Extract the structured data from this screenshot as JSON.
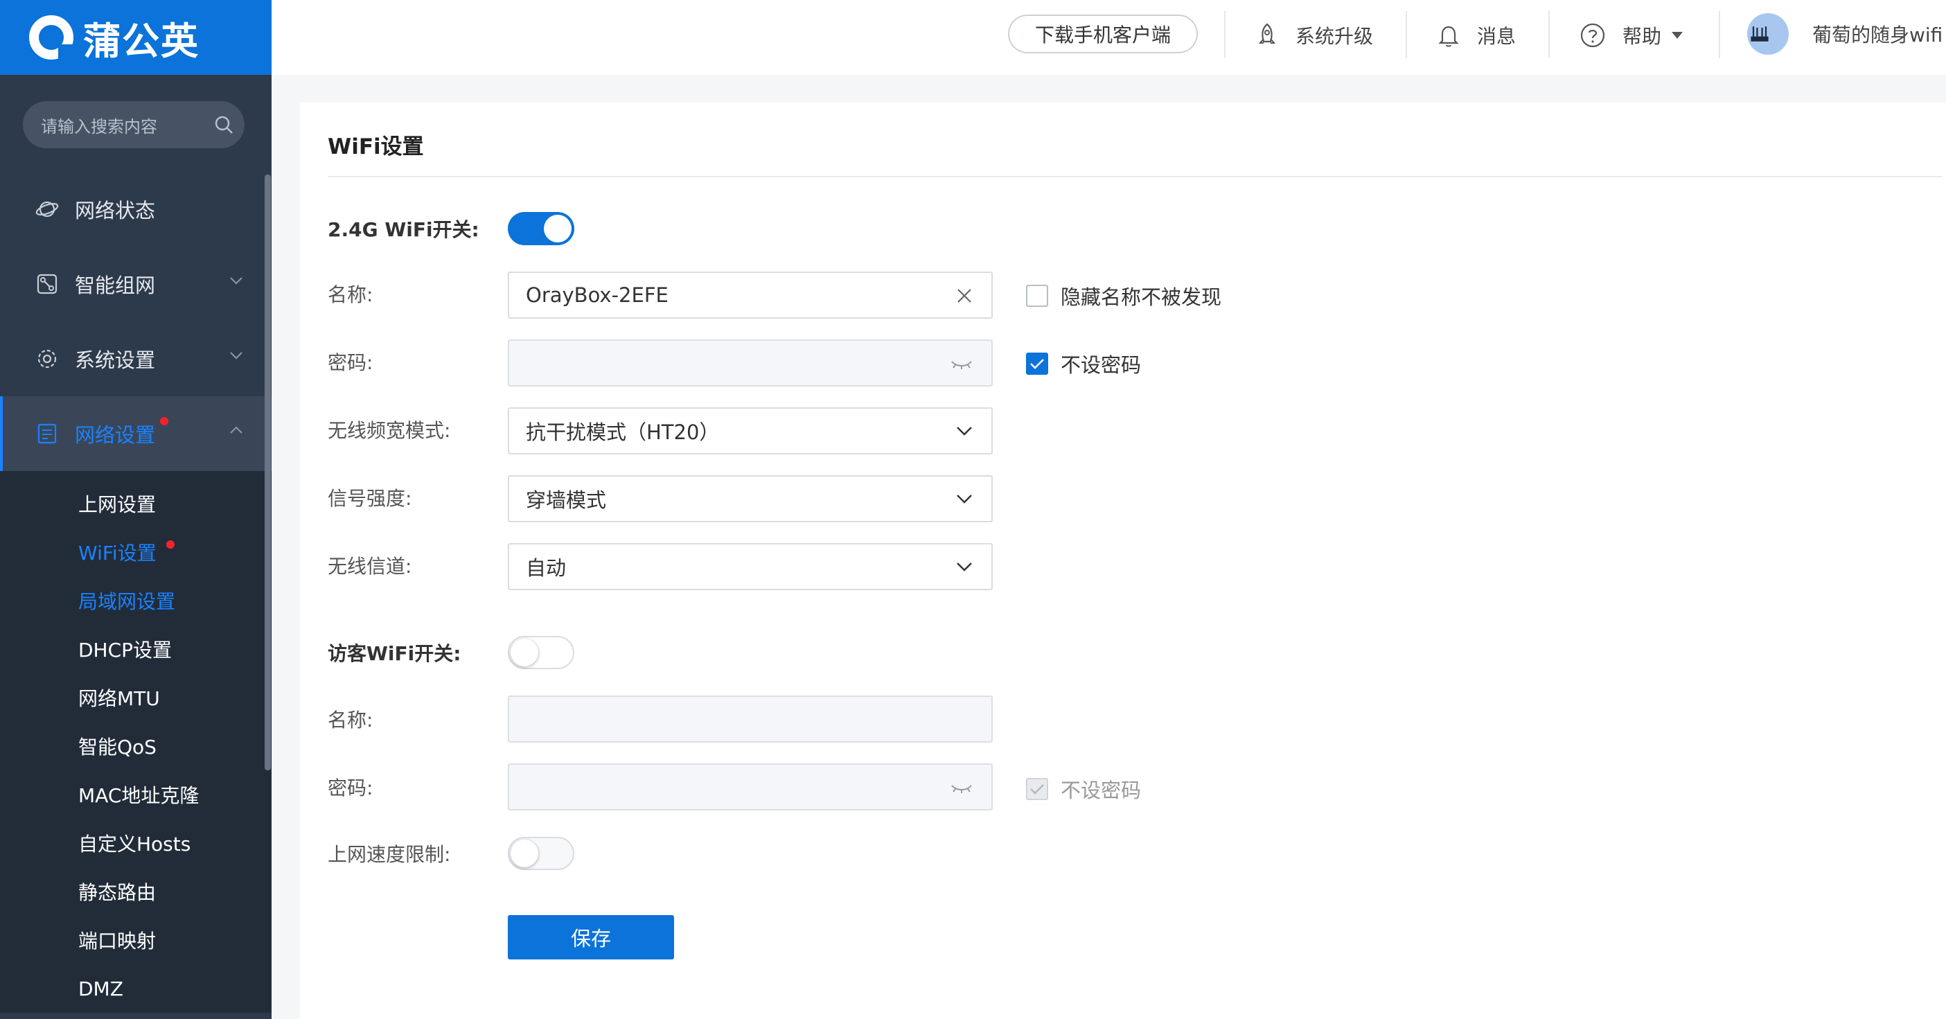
{
  "brand": {
    "name": "蒲公英"
  },
  "sidebar": {
    "search_placeholder": "请输入搜索内容",
    "menu": [
      {
        "label": "网络状态",
        "icon": "planet-icon"
      },
      {
        "label": "智能组网",
        "icon": "network-icon"
      },
      {
        "label": "系统设置",
        "icon": "gear-icon"
      },
      {
        "label": "网络设置",
        "icon": "document-icon"
      }
    ],
    "submenu": [
      {
        "label": "上网设置"
      },
      {
        "label": "WiFi设置"
      },
      {
        "label": "局域网设置"
      },
      {
        "label": "DHCP设置"
      },
      {
        "label": "网络MTU"
      },
      {
        "label": "智能QoS"
      },
      {
        "label": "MAC地址克隆"
      },
      {
        "label": "自定义Hosts"
      },
      {
        "label": "静态路由"
      },
      {
        "label": "端口映射"
      },
      {
        "label": "DMZ"
      }
    ]
  },
  "header": {
    "download_label": "下载手机客户端",
    "upgrade_label": "系统升级",
    "messages_label": "消息",
    "help_label": "帮助",
    "device_name": "葡萄的随身wifi"
  },
  "page": {
    "title": "WiFi设置",
    "wifi24": {
      "switch_label": "2.4G WiFi开关:",
      "switch_on": true,
      "name_label": "名称:",
      "name_value": "OrayBox-2EFE",
      "hide_name_label": "隐藏名称不被发现",
      "hide_name_checked": false,
      "password_label": "密码:",
      "password_value": "",
      "no_password_label": "不设密码",
      "no_password_checked": true,
      "bandwidth_label": "无线频宽模式:",
      "bandwidth_value": "抗干扰模式（HT20）",
      "signal_label": "信号强度:",
      "signal_value": "穿墙模式",
      "channel_label": "无线信道:",
      "channel_value": "自动"
    },
    "guest": {
      "switch_label": "访客WiFi开关:",
      "switch_on": false,
      "name_label": "名称:",
      "name_value": "",
      "password_label": "密码:",
      "password_value": "",
      "no_password_label": "不设密码",
      "no_password_checked": true,
      "speed_limit_label": "上网速度限制:",
      "speed_limit_on": false
    },
    "save_label": "保存"
  },
  "colors": {
    "primary": "#0b73d9",
    "sidebar_bg": "#2d3a4b",
    "active_text": "#1a82ff",
    "badge_red": "#f5222d"
  }
}
